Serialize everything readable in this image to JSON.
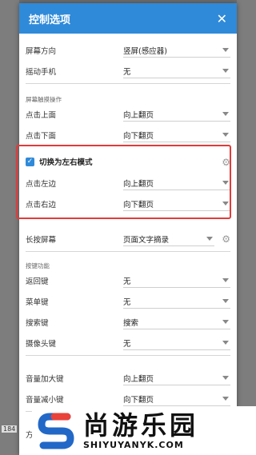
{
  "dialog": {
    "title": "控制选项",
    "close_icon": "close-icon"
  },
  "rows_top": [
    {
      "label": "屏幕方向",
      "value": "竖屏(感应器)"
    },
    {
      "label": "摇动手机",
      "value": "无"
    }
  ],
  "section_tap": {
    "label": "屏幕触摸操作"
  },
  "rows_tap": [
    {
      "label": "点击上面",
      "value": "向上翻页"
    },
    {
      "label": "点击下面",
      "value": "向下翻页"
    }
  ],
  "lr_mode": {
    "label": "切换为左右模式",
    "checked": true
  },
  "rows_lr": [
    {
      "label": "点击左边",
      "value": "向上翻页"
    },
    {
      "label": "点击右边",
      "value": "向下翻页"
    }
  ],
  "long_press": {
    "label": "长按屏幕",
    "value": "页面文字摘录"
  },
  "section_keys": {
    "label": "按键功能"
  },
  "rows_keys": [
    {
      "label": "返回键",
      "value": "无"
    },
    {
      "label": "菜单键",
      "value": "无"
    },
    {
      "label": "搜索键",
      "value": "搜索"
    },
    {
      "label": "摄像头键",
      "value": "无"
    }
  ],
  "rows_volume": [
    {
      "label": "音量加大键",
      "value": "向上翻页"
    },
    {
      "label": "音量减小键",
      "value": "向下翻页"
    }
  ],
  "row_partial": {
    "label": "方"
  },
  "page_tag": "184",
  "watermark": {
    "cn": "尚游乐园",
    "en": "SHIYUYANYK.COM"
  },
  "colors": {
    "header": "#2f8ad9",
    "highlight": "#e23b3b",
    "logo_red": "#e8423a",
    "logo_blue": "#2268c7"
  }
}
